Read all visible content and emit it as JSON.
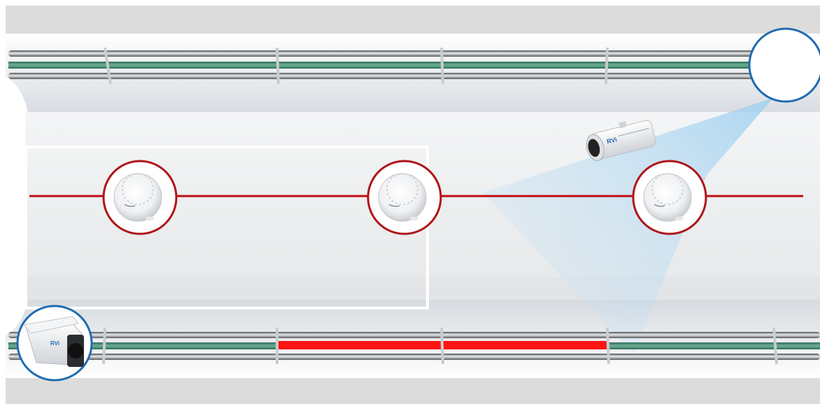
{
  "scene": {
    "description_free": true,
    "colors": {
      "floor": "#dcdcdc",
      "wall_light": "#f2f4f6",
      "wall_shade": "#d7dbe0",
      "ceiling": "#eceef0",
      "pipe_dark": "#5b5e62",
      "pipe_light": "#d9dcdf",
      "cable_green": "#4a8f76",
      "alarm_segment": "#ff1414",
      "detector_line": "#c00d12",
      "detector_ring": "#b01418",
      "zone_frame": "#ffffff",
      "camera_ring": "#1f6bb2",
      "camera_cone": "#bfe0f5"
    },
    "icons": {
      "smoke_detector": "smoke-detector-icon",
      "dome_camera": "bullet-camera-icon",
      "corner_camera": "bullet-camera-icon"
    },
    "detectors": [
      "detector-1",
      "detector-2",
      "detector-3"
    ],
    "camera_brand": "RVi"
  }
}
